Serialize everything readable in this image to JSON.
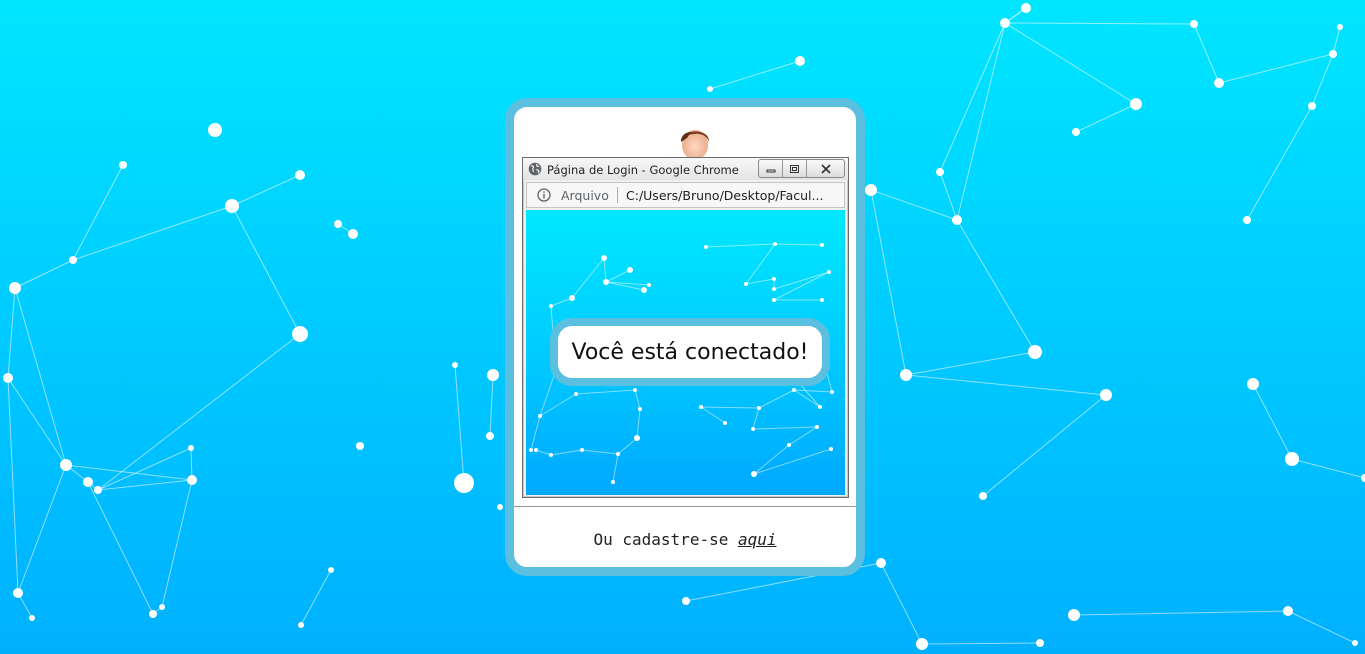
{
  "popup": {
    "title": "Página de Login - Google Chrome",
    "address_scheme": "Arquivo",
    "address_url": "C:/Users/Bruno/Desktop/Facul..."
  },
  "message": "Você está conectado!",
  "footer": {
    "text": "Ou cadastre-se ",
    "link_label": "aqui"
  },
  "icons": {
    "avatar": "user-avatar-icon",
    "globe": "globe-icon",
    "info": "info-icon",
    "minimize": "minimize-icon",
    "restore": "restore-icon",
    "close": "close-icon"
  },
  "colors": {
    "accent_border": "#5bbfdf",
    "background_top": "#00e6ff",
    "background_bottom": "#00b0ff"
  }
}
